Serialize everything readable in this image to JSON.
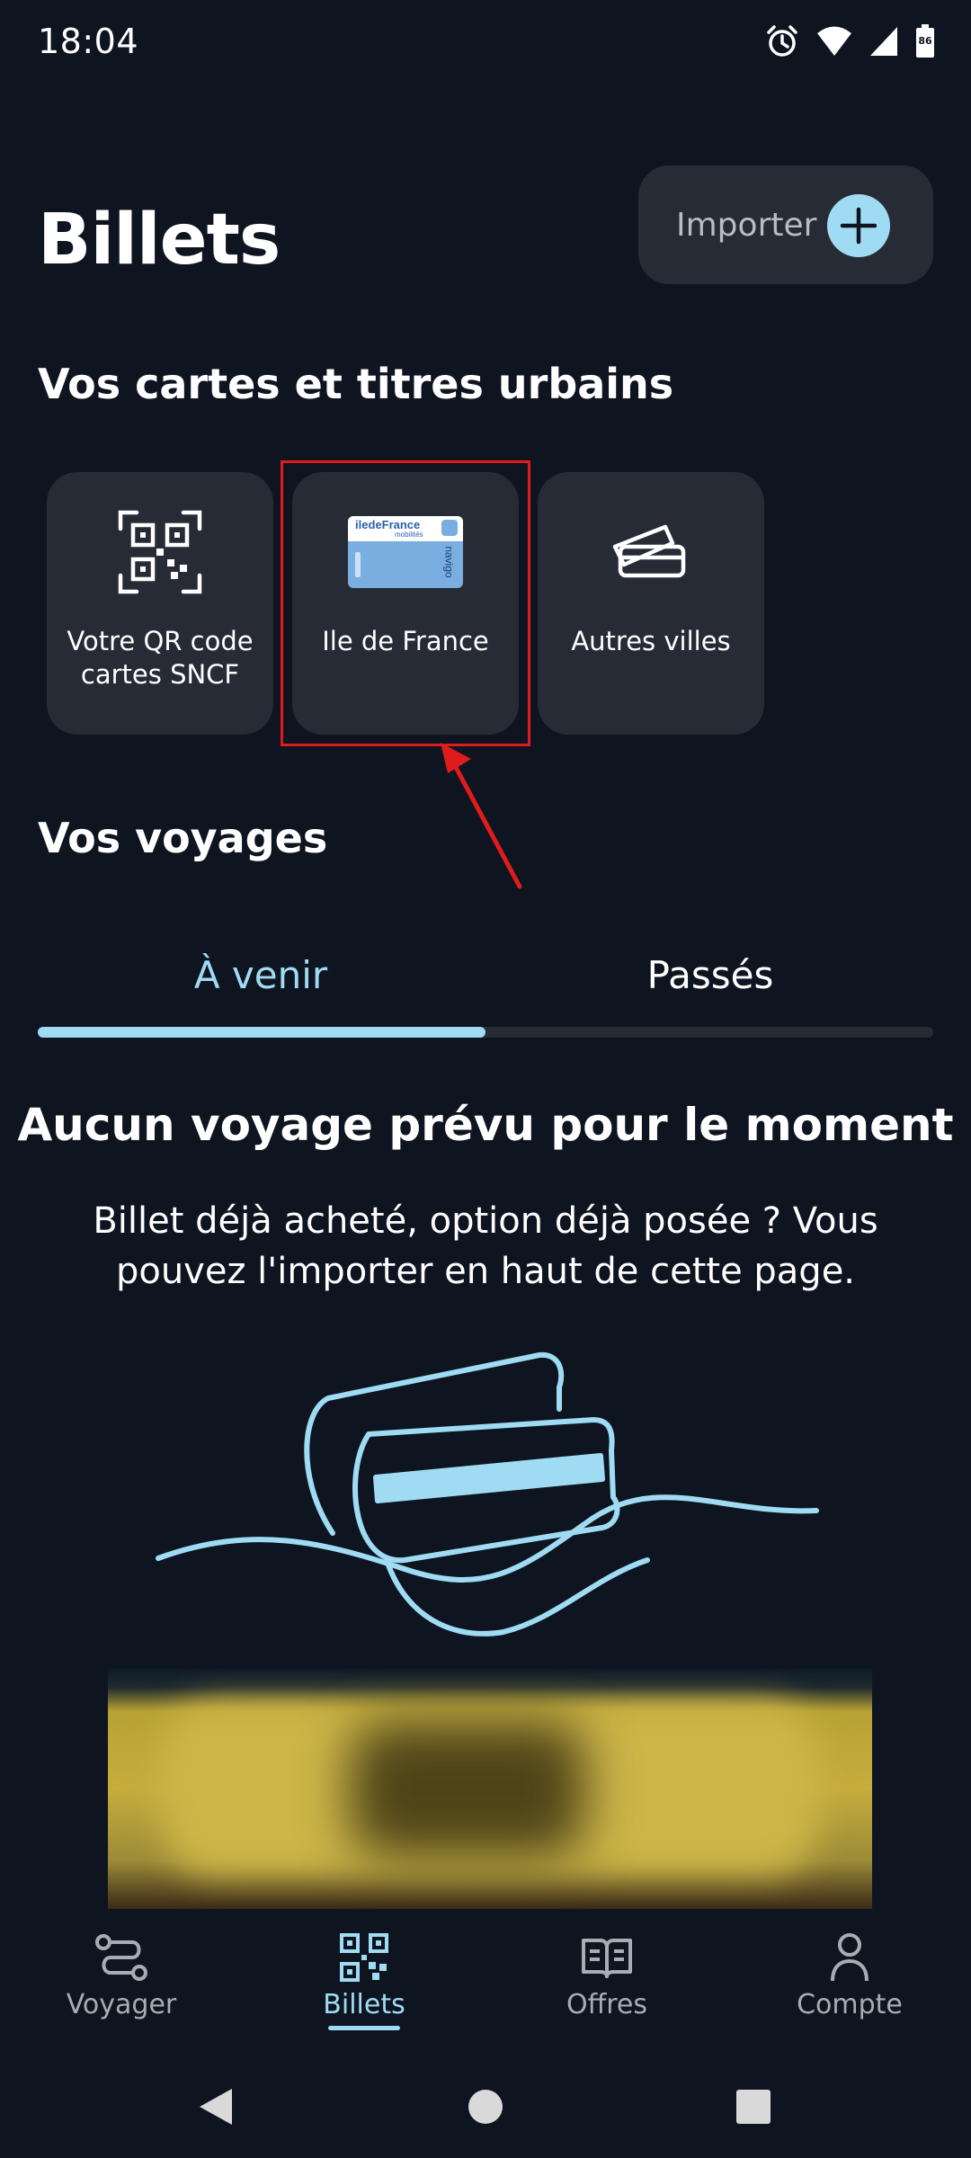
{
  "status_bar": {
    "time": "18:04",
    "battery": "86",
    "icons": [
      "alarm-icon",
      "wifi-icon",
      "signal-icon",
      "battery-icon"
    ]
  },
  "header": {
    "title": "Billets",
    "import_label": "Importer"
  },
  "cards_section": {
    "title": "Vos cartes et titres urbains",
    "cards": [
      {
        "label": "Votre QR code cartes SNCF",
        "icon": "qr-code-icon"
      },
      {
        "label": "Ile de France",
        "icon": "navigo-card-icon",
        "card_brand": "iledeFrance",
        "card_sub": "mobilités",
        "card_vertical": "navigo"
      },
      {
        "label": "Autres villes",
        "icon": "tickets-icon"
      }
    ]
  },
  "voyages_section": {
    "title": "Vos voyages",
    "tabs": [
      {
        "label": "À venir",
        "active": true
      },
      {
        "label": "Passés",
        "active": false
      }
    ]
  },
  "empty_state": {
    "title": "Aucun voyage prévu pour le moment",
    "body": "Billet déjà acheté, option déjà posée ? Vous pouvez l'importer en haut de cette page."
  },
  "bottom_nav": {
    "items": [
      {
        "label": "Voyager",
        "icon": "route-icon",
        "active": false
      },
      {
        "label": "Billets",
        "icon": "qr-code-icon",
        "active": true
      },
      {
        "label": "Offres",
        "icon": "book-icon",
        "active": false
      },
      {
        "label": "Compte",
        "icon": "person-icon",
        "active": false
      }
    ]
  },
  "colors": {
    "background": "#0f1421",
    "surface": "#272b36",
    "accent": "#9fdcf4",
    "highlight": "#e01b1b"
  }
}
